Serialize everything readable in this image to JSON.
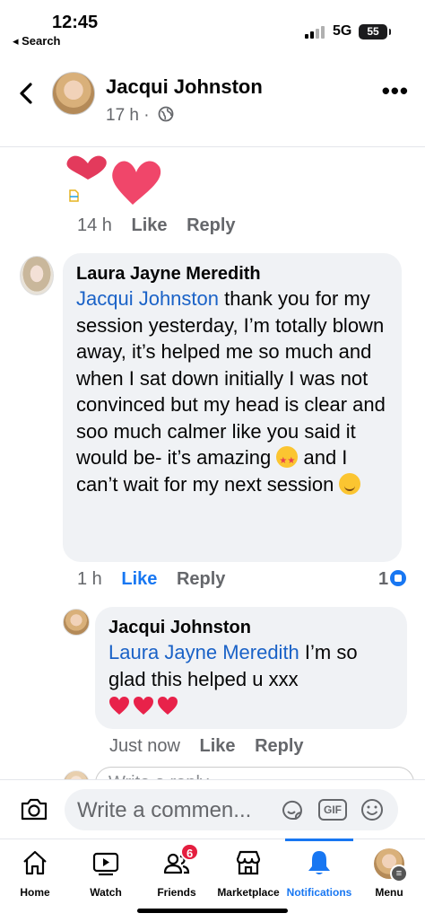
{
  "status_bar": {
    "time": "12:45",
    "back_label": "◂ Search",
    "network": "5G",
    "battery": "55"
  },
  "header": {
    "name": "Jacqui Johnston",
    "time": "17 h ·",
    "more": "•••"
  },
  "prev_comment": {
    "time": "14 h",
    "like": "Like",
    "reply": "Reply"
  },
  "comment_laura": {
    "author": "Laura Jayne Meredith",
    "mention": "Jacqui Johnston",
    "text_1": " thank you for my session yesterday, I’m totally blown away, it’s helped me so much and when I sat down initially I was not convinced but my head is clear and soo much calmer like you said it would be- it’s amazing ",
    "text_2": " and I can’t wait for my next session ",
    "time": "1 h",
    "like": "Like",
    "reply": "Reply",
    "reaction_count": "1"
  },
  "comment_jacqui": {
    "author": "Jacqui Johnston",
    "mention": "Laura Jayne Meredith",
    "text": " I’m so glad this helped u xxx",
    "time": "Just now",
    "like": "Like",
    "reply": "Reply"
  },
  "reply_box": {
    "placeholder": "Write a reply..."
  },
  "composer": {
    "placeholder": "Write a commen...",
    "gif": "GIF"
  },
  "tabs": [
    {
      "label": "Home"
    },
    {
      "label": "Watch"
    },
    {
      "label": "Friends",
      "badge": "6"
    },
    {
      "label": "Marketplace"
    },
    {
      "label": "Notifications"
    },
    {
      "label": "Menu"
    }
  ],
  "colors": {
    "accent": "#1877f2",
    "mention": "#1a62c7",
    "bubble": "#f0f2f5",
    "muted": "#65676b",
    "badge": "#e41e3f",
    "heart": "#e8224a"
  },
  "icons": [
    "back-chevron-icon",
    "globe-icon",
    "more-icon",
    "camera-icon",
    "sticker-icon",
    "emoji-icon",
    "home-icon",
    "watch-icon",
    "friends-icon",
    "marketplace-icon",
    "bell-icon"
  ]
}
